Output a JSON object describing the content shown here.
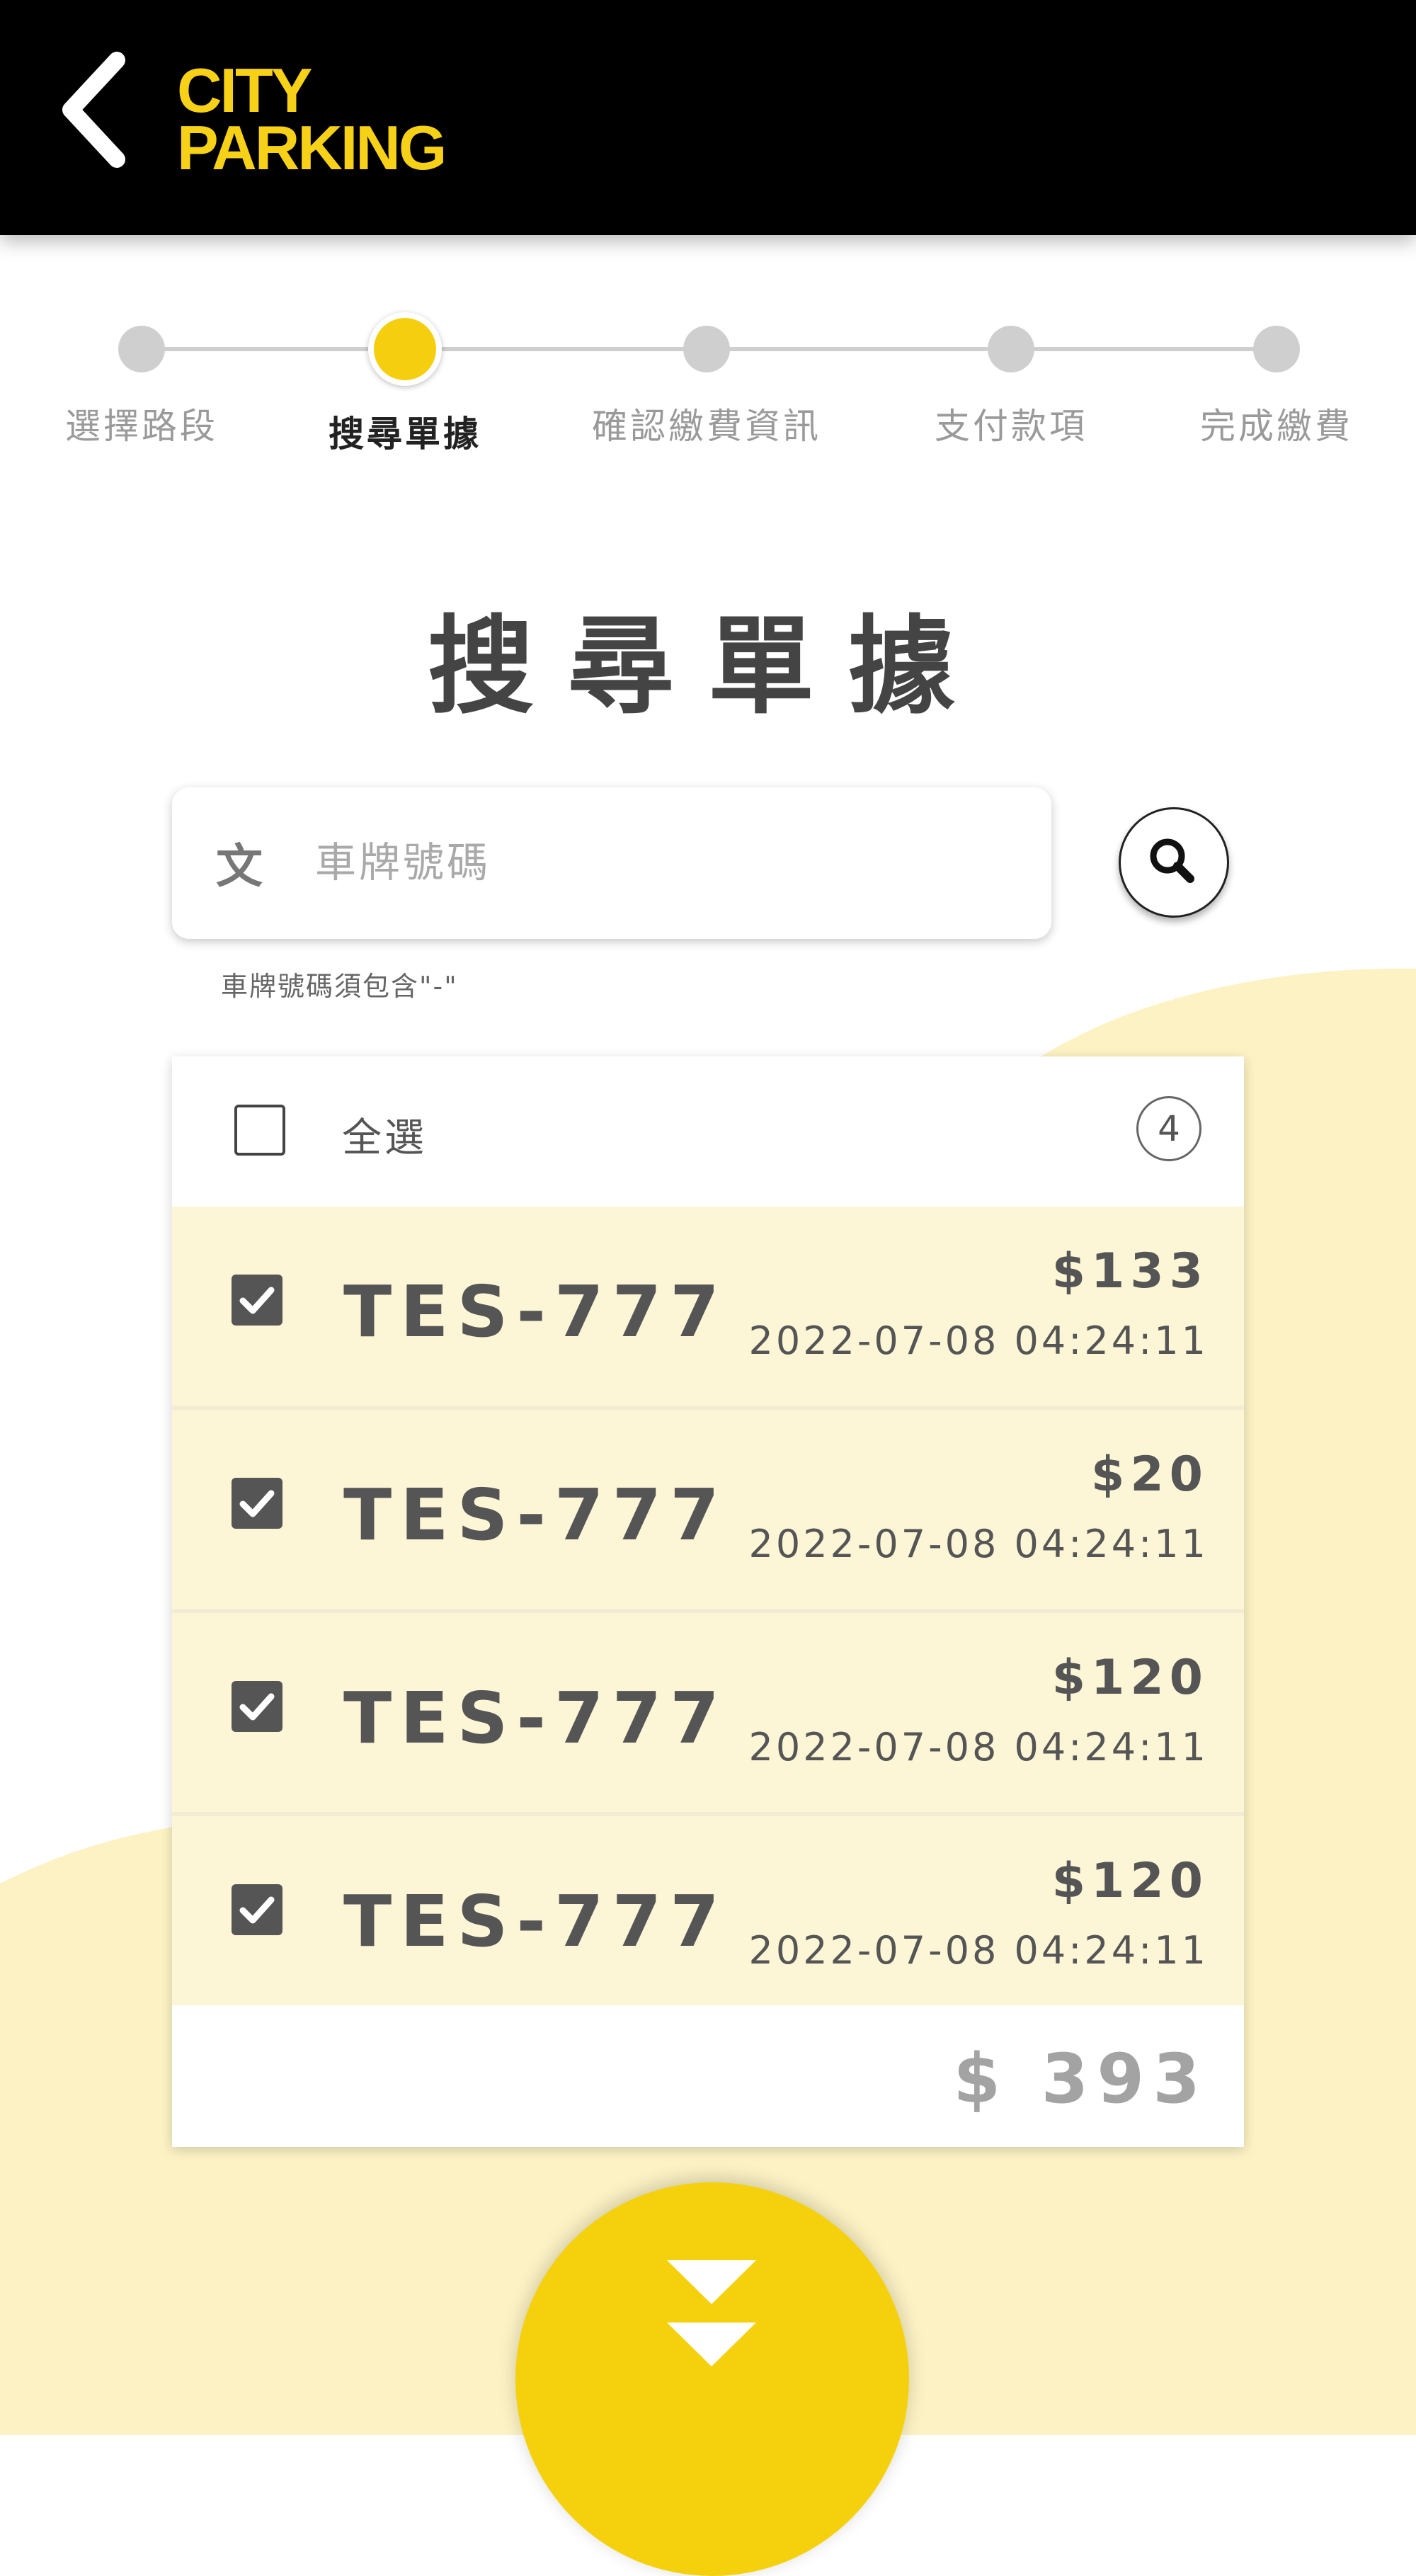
{
  "header": {
    "back_icon": "chevron-left-icon",
    "logo_line1": "CITY",
    "logo_line2": "PARKING",
    "logo_color": "#f7d117"
  },
  "stepper": {
    "steps": [
      {
        "label": "選擇路段",
        "active": false
      },
      {
        "label": "搜尋單據",
        "active": true
      },
      {
        "label": "確認繳費資訊",
        "active": false
      },
      {
        "label": "支付款項",
        "active": false
      },
      {
        "label": "完成繳費",
        "active": false
      }
    ]
  },
  "page": {
    "title": "搜尋單據"
  },
  "search": {
    "input_icon": "文",
    "placeholder": "車牌號碼",
    "value": "",
    "hint": "車牌號碼須包含\"-\"",
    "button_icon": "search-icon"
  },
  "list": {
    "select_all_label": "全選",
    "select_all_checked": false,
    "count": "4",
    "items": [
      {
        "plate": "TES-777",
        "amount": "$133",
        "time": "2022-07-08 04:24:11",
        "checked": true
      },
      {
        "plate": "TES-777",
        "amount": "$20",
        "time": "2022-07-08 04:24:11",
        "checked": true
      },
      {
        "plate": "TES-777",
        "amount": "$120",
        "time": "2022-07-08 04:24:11",
        "checked": true
      },
      {
        "plate": "TES-777",
        "amount": "$120",
        "time": "2022-07-08 04:24:11",
        "checked": true
      }
    ],
    "total": "$ 393"
  },
  "next_button": {
    "icon": "double-chevron-down-icon",
    "color": "#f5d10d"
  },
  "colors": {
    "accent": "#f5cf0f",
    "row_background": "#fdf6d6",
    "wave_background": "#fcf2c4"
  }
}
